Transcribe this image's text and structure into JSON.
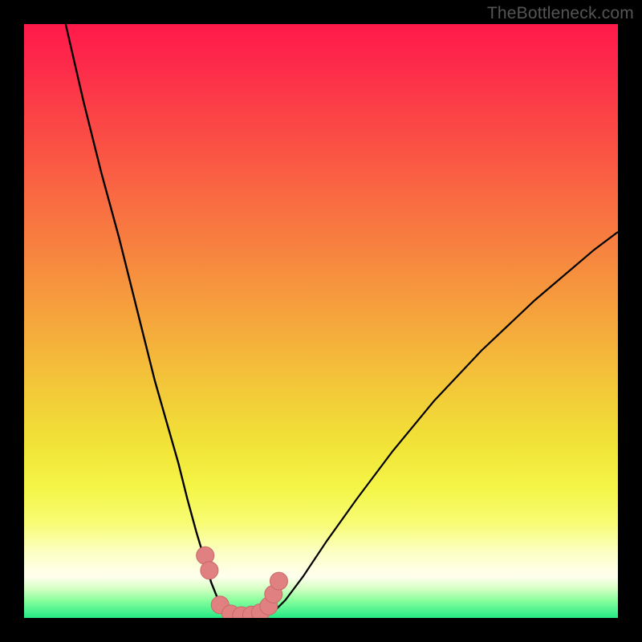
{
  "watermark": "TheBottleneck.com",
  "colors": {
    "frame": "#000000",
    "curve": "#000000",
    "marker_fill": "#e08080",
    "marker_stroke": "#c86868",
    "gradient_top": "#ff1a4a",
    "gradient_bottom": "#24ea85"
  },
  "chart_data": {
    "type": "line",
    "title": "",
    "xlabel": "",
    "ylabel": "",
    "xlim": [
      0,
      100
    ],
    "ylim": [
      0,
      100
    ],
    "background": "red-yellow-green vertical gradient",
    "grid": false,
    "legend": false,
    "series": [
      {
        "name": "left-curve",
        "x": [
          7,
          10,
          13,
          16,
          18,
          20,
          22,
          24,
          26,
          27.5,
          29,
          30.5,
          31.5,
          32.5,
          33.5,
          34.5
        ],
        "y": [
          100,
          87,
          75,
          64,
          56,
          48,
          40,
          33,
          26,
          20,
          14.5,
          9.5,
          6,
          3.5,
          1.8,
          0.6
        ]
      },
      {
        "name": "right-curve",
        "x": [
          42,
          44,
          47,
          51,
          56,
          62,
          69,
          77,
          86,
          96,
          100
        ],
        "y": [
          1.0,
          3.0,
          7.0,
          13,
          20,
          28,
          36.5,
          45,
          53.5,
          62,
          65
        ]
      },
      {
        "name": "valley-markers",
        "x": [
          30.5,
          31.2,
          33.0,
          34.8,
          36.6,
          38.3,
          39.8,
          41.2,
          42.0,
          42.9
        ],
        "y": [
          10.5,
          8.0,
          2.2,
          0.7,
          0.4,
          0.5,
          0.9,
          2.0,
          4.0,
          6.2
        ]
      }
    ]
  }
}
